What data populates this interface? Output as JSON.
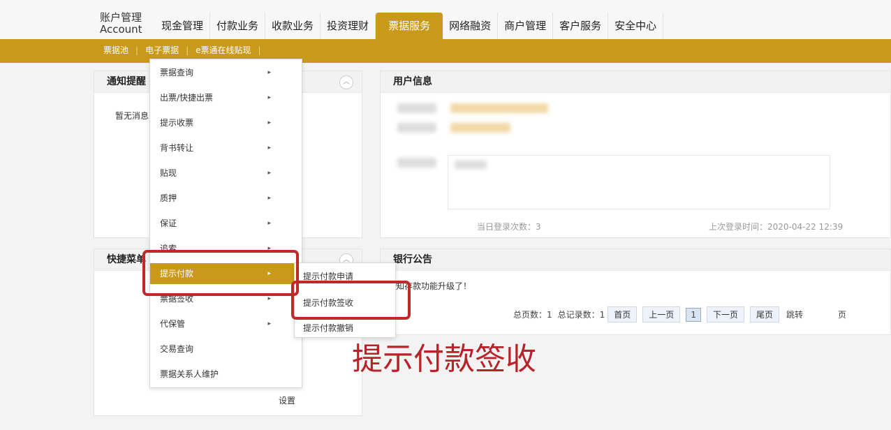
{
  "brand": {
    "line1": "账户管理",
    "line2": "Account"
  },
  "nav_tabs": [
    "现金管理",
    "付款业务",
    "收款业务",
    "投资理财",
    "票据服务",
    "网络融资",
    "商户管理",
    "客户服务",
    "安全中心"
  ],
  "sub_nav": [
    "票据池",
    "电子票据",
    "e票通在线贴现"
  ],
  "sub_sep": "|",
  "notice_panel": {
    "title": "通知提醒",
    "empty_text": "暂无消息"
  },
  "user_panel": {
    "title": "用户信息",
    "login_count_label": "当日登录次数：3",
    "last_login_label": "上次登录时间：2020-04-22 12:39"
  },
  "shortcut_panel": {
    "title": "快捷菜单",
    "settings_label": "设置"
  },
  "bank_notice": {
    "title": "银行公告",
    "line": "通知存款功能升级了！",
    "pager": {
      "total_pages": "总页数：1",
      "total_records": "总记录数：1",
      "first": "首页",
      "prev": "上一页",
      "current": "1",
      "next": "下一页",
      "last": "尾页",
      "jump": "跳转",
      "page_unit": "页"
    }
  },
  "menu": {
    "items": [
      "票据查询",
      "出票/快捷出票",
      "提示收票",
      "背书转让",
      "贴现",
      "质押",
      "保证",
      "追索",
      "提示付款",
      "票据签收",
      "代保管",
      "交易查询",
      "票据关系人维护"
    ],
    "arrow": "▸"
  },
  "submenu": {
    "items": [
      "提示付款申请",
      "提示付款签收",
      "提示付款撤销"
    ]
  },
  "caption": "提示付款签收",
  "colors": {
    "gold": "#c99a1a",
    "red": "#c0282a"
  }
}
